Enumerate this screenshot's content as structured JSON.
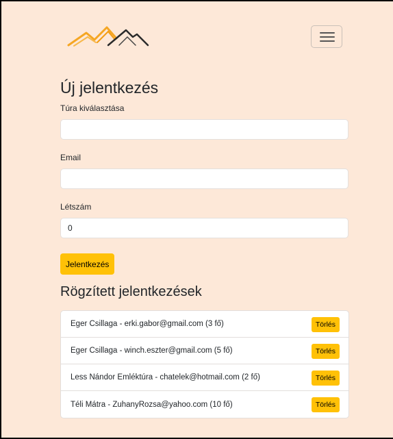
{
  "colors": {
    "background": "#fde8d8",
    "accent": "#ffc107",
    "logo_orange": "#f5a623",
    "logo_dark": "#2b2b2b"
  },
  "header": {
    "logo_icon": "mountain-logo-icon",
    "menu_icon": "hamburger-menu-icon"
  },
  "form": {
    "title": "Új jelentkezés",
    "tour_label": "Túra kiválasztása",
    "tour_value": "",
    "email_label": "Email",
    "email_value": "",
    "count_label": "Létszám",
    "count_value": "0",
    "submit_label": "Jelentkezés"
  },
  "registrations": {
    "title": "Rögzített jelentkezések",
    "delete_label": "Törlés",
    "items": [
      {
        "text": "Eger Csillaga - erki.gabor@gmail.com (3 fő)"
      },
      {
        "text": "Eger Csillaga - winch.eszter@gmail.com (5 fő)"
      },
      {
        "text": "Less Nándor Emléktúra - chatelek@hotmail.com (2 fő)"
      },
      {
        "text": "Téli Mátra - ZuhanyRozsa@yahoo.com (10 fő)"
      }
    ]
  }
}
